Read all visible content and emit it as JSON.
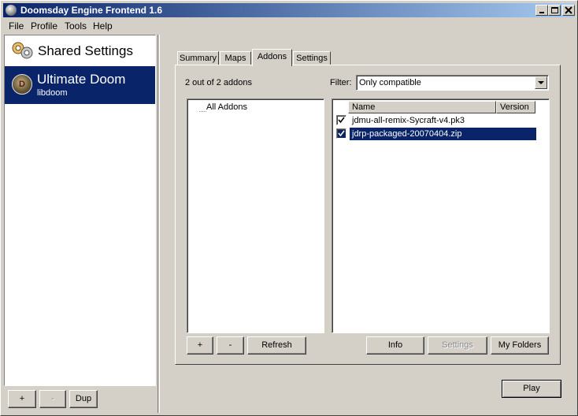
{
  "window": {
    "title": "Doomsday Engine Frontend 1.6"
  },
  "menubar": {
    "items": [
      "File",
      "Profile",
      "Tools",
      "Help"
    ]
  },
  "sidebar": {
    "shared_settings_label": "Shared Settings",
    "profiles": [
      {
        "name": "Ultimate Doom",
        "game": "libdoom",
        "selected": true
      }
    ],
    "buttons": {
      "add": "+",
      "remove": "-",
      "dup": "Dup"
    }
  },
  "tabs": [
    {
      "label": "Summary",
      "active": false
    },
    {
      "label": "Maps",
      "active": false
    },
    {
      "label": "Addons",
      "active": true
    },
    {
      "label": "Settings",
      "active": false
    }
  ],
  "addons": {
    "count_text": "2 out of 2 addons",
    "filter_label": "Filter:",
    "filter_value": "Only compatible",
    "tree": {
      "root_label": "All Addons"
    },
    "columns": {
      "name": "Name",
      "version": "Version"
    },
    "rows": [
      {
        "name": "jdmu-all-remix-Sycraft-v4.pk3",
        "checked": true,
        "selected": false
      },
      {
        "name": "jdrp-packaged-20070404.zip",
        "checked": true,
        "selected": true
      }
    ],
    "buttons": {
      "add": "+",
      "remove": "-",
      "refresh": "Refresh",
      "info": "Info",
      "settings": "Settings",
      "my_folders": "My Folders"
    }
  },
  "footer": {
    "play_label": "Play"
  },
  "colors": {
    "selection": "#0a246a",
    "face": "#d4d0c8"
  }
}
